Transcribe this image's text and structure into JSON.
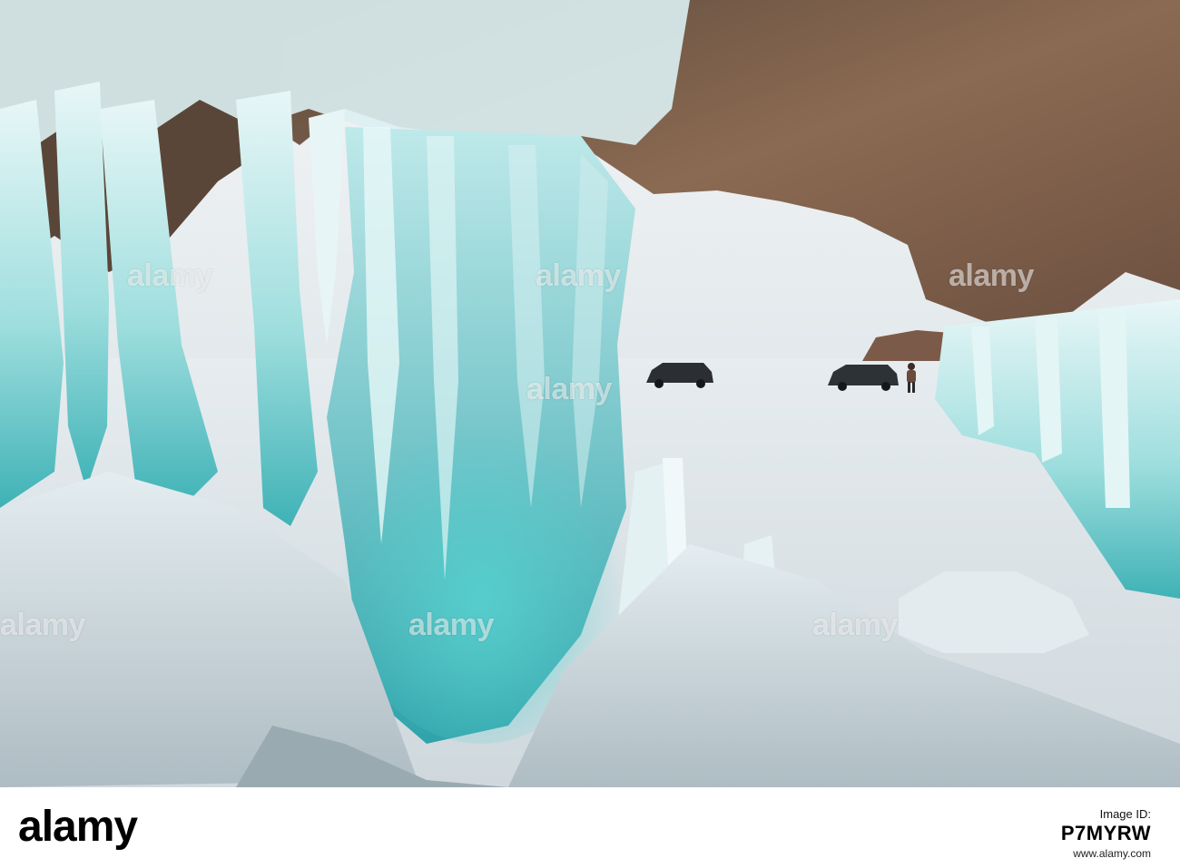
{
  "image": {
    "subject": "ice cave with icicles on a frozen lake, two SUVs and a person",
    "colors": {
      "ice_teal": "#4fc3c4",
      "ice_light": "#cfeef0",
      "rock_brown": "#7a5a44",
      "sky": "#eef1f2",
      "lake": "#dfe6ea"
    }
  },
  "watermarks": {
    "text": "alamy"
  },
  "footer": {
    "logo": "alamy",
    "id_label": "Image ID:",
    "id_code": "P7MYRW",
    "url": "www.alamy.com"
  }
}
